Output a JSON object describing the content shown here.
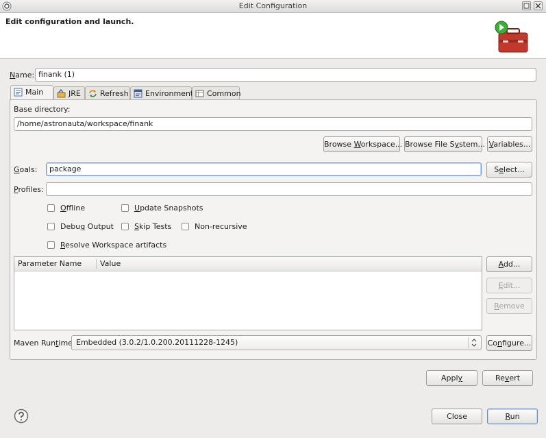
{
  "window": {
    "title": "Edit Configuration"
  },
  "banner": {
    "title": "Edit configuration and launch."
  },
  "name_field": {
    "label": "Name:",
    "value": "finank (1)"
  },
  "tabs": [
    {
      "label": "Main",
      "icon": "main-tab-icon",
      "active": true
    },
    {
      "label": "JRE",
      "icon": "jre-icon",
      "active": false
    },
    {
      "label": "Refresh",
      "icon": "refresh-icon",
      "active": false
    },
    {
      "label": "Environment",
      "icon": "environment-icon",
      "active": false
    },
    {
      "label": "Common",
      "icon": "common-icon",
      "active": false
    }
  ],
  "main": {
    "base_directory_label": "Base directory:",
    "base_directory_value": "/home/astronauta/workspace/finank",
    "browse_workspace": "Browse Workspace...",
    "browse_file_system": "Browse File System...",
    "variables": "Variables...",
    "goals_label": "Goals:",
    "goals_value": "package",
    "select": "Select...",
    "profiles_label": "Profiles:",
    "profiles_value": "",
    "checkboxes": {
      "offline": "Offline",
      "update_snapshots": "Update Snapshots",
      "debug_output": "Debug Output",
      "skip_tests": "Skip Tests",
      "non_recursive": "Non-recursive",
      "resolve_workspace": "Resolve Workspace artifacts"
    },
    "table": {
      "columns": [
        "Parameter Name",
        "Value"
      ],
      "rows": []
    },
    "add": "Add...",
    "edit": "Edit...",
    "remove": "Remove",
    "runtime_label": "Maven Runtime:",
    "runtime_value": "Embedded (3.0.2/1.0.200.20111228-1245)",
    "configure": "Configure..."
  },
  "actions": {
    "apply": "Apply",
    "revert": "Revert",
    "close": "Close",
    "run": "Run"
  },
  "colors": {
    "focus_border": "#6f9bd6",
    "default_button_border": "#6e8fba"
  }
}
